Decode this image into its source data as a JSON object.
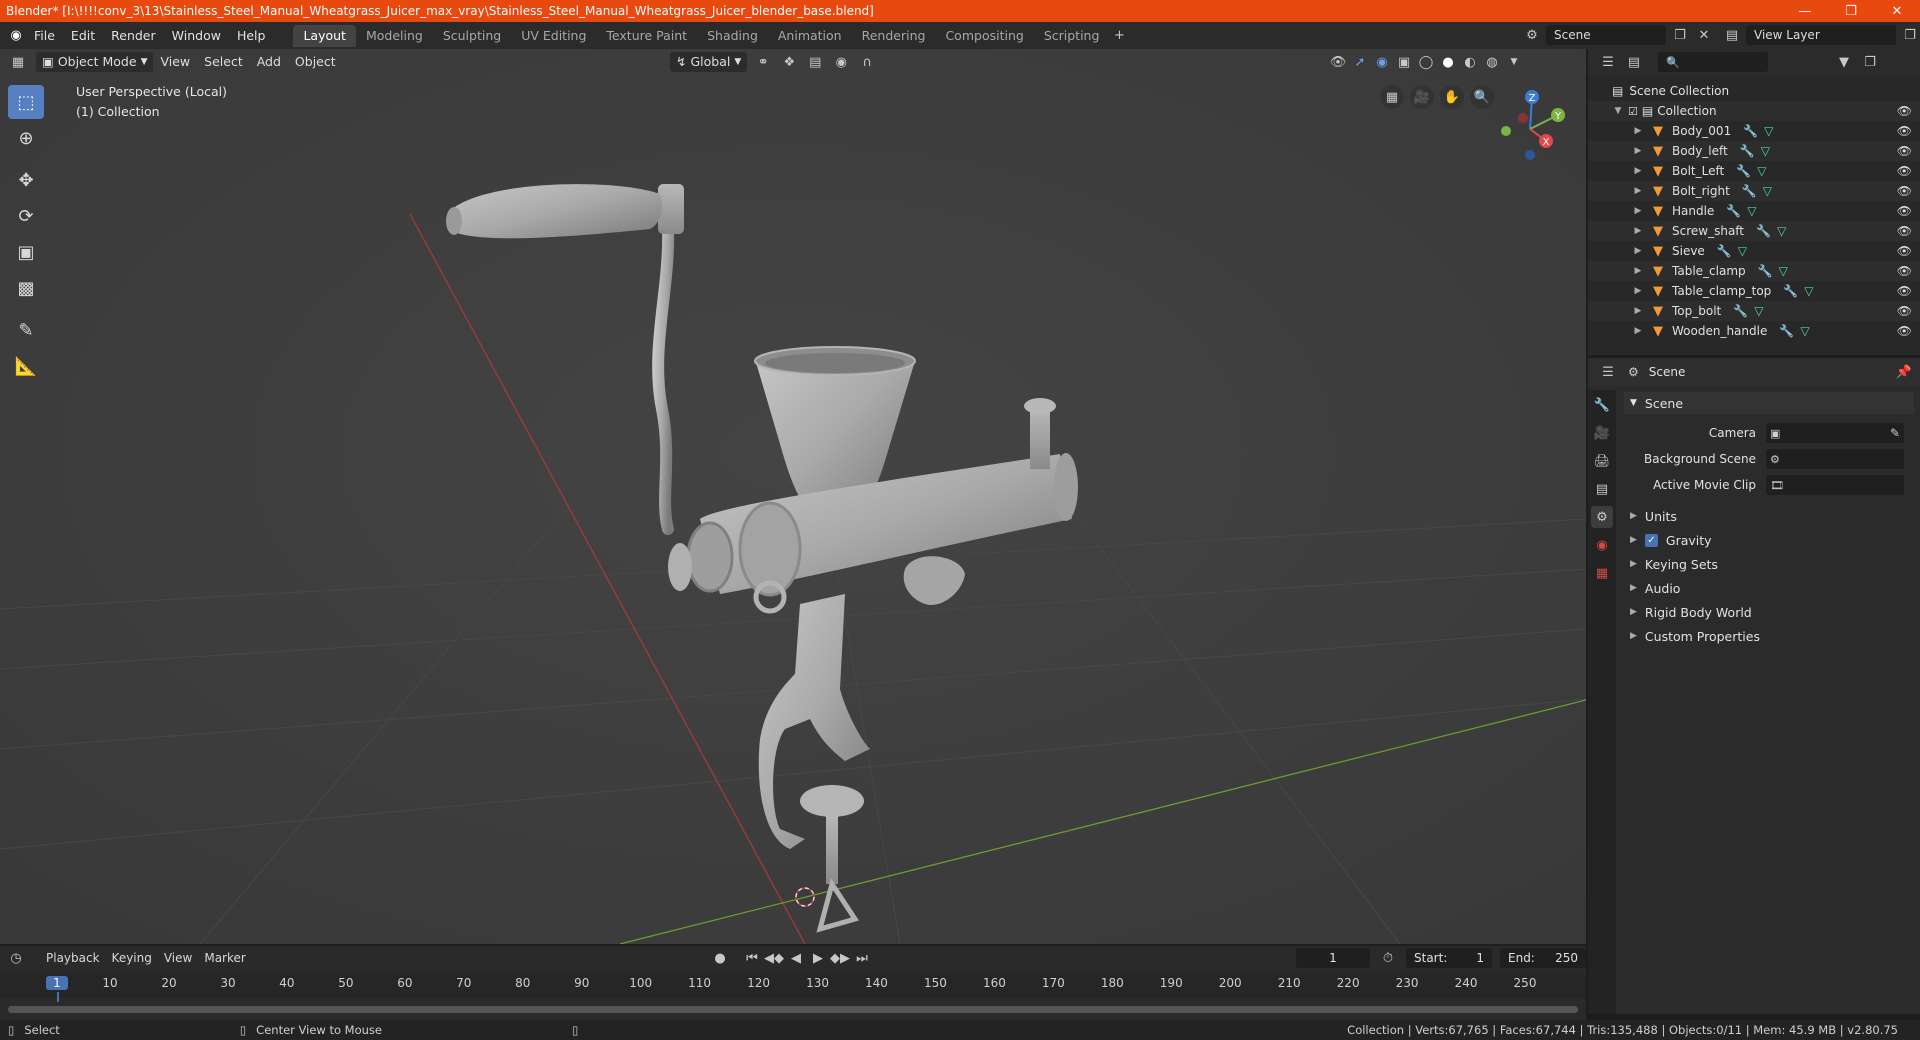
{
  "window": {
    "title": "Blender* [I:\\!!!!conv_3\\13\\Stainless_Steel_Manual_Wheatgrass_Juicer_max_vray\\Stainless_Steel_Manual_Wheatgrass_Juicer_blender_base.blend]",
    "accent": "#e8490f"
  },
  "menu": [
    "File",
    "Edit",
    "Render",
    "Window",
    "Help"
  ],
  "workspaces": [
    "Layout",
    "Modeling",
    "Sculpting",
    "UV Editing",
    "Texture Paint",
    "Shading",
    "Animation",
    "Rendering",
    "Compositing",
    "Scripting"
  ],
  "active_workspace": "Layout",
  "scene_field": "Scene",
  "view_layer_field": "View Layer",
  "viewport": {
    "mode": "Object Mode",
    "menus": [
      "View",
      "Select",
      "Add",
      "Object"
    ],
    "orientation": "Global",
    "overlay_line1": "User Perspective (Local)",
    "overlay_line2": "(1) Collection",
    "gizmo_labels": {
      "z": "Z",
      "y": "Y",
      "x": "X"
    }
  },
  "outliner": {
    "root": "Scene Collection",
    "collection": "Collection",
    "objects": [
      "Body_001",
      "Body_left",
      "Bolt_Left",
      "Bolt_right",
      "Handle",
      "Screw_shaft",
      "Sieve",
      "Table_clamp",
      "Table_clamp_top",
      "Top_bolt",
      "Wooden_handle"
    ]
  },
  "properties": {
    "context": "Scene",
    "panel": "Scene",
    "camera_label": "Camera",
    "bg_scene_label": "Background Scene",
    "movie_clip_label": "Active Movie Clip",
    "subpanels": [
      "Units",
      "Gravity",
      "Keying Sets",
      "Audio",
      "Rigid Body World",
      "Custom Properties"
    ],
    "gravity_checked": true
  },
  "timeline": {
    "menus": [
      "Playback",
      "Keying",
      "View",
      "Marker"
    ],
    "current_frame": "1",
    "start_label": "Start:",
    "start": "1",
    "end_label": "End:",
    "end": "250",
    "ticks": [
      "1",
      "10",
      "20",
      "30",
      "40",
      "50",
      "60",
      "70",
      "80",
      "90",
      "100",
      "110",
      "120",
      "130",
      "140",
      "150",
      "160",
      "170",
      "180",
      "190",
      "200",
      "210",
      "220",
      "230",
      "240",
      "250"
    ]
  },
  "status": {
    "left": "Select",
    "middle": "Center View to Mouse",
    "right": "Collection | Verts:67,765 | Faces:67,744 | Tris:135,488 | Objects:0/11 | Mem: 45.9 MB | v2.80.75"
  }
}
